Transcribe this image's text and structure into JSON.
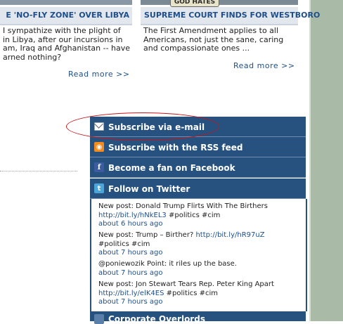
{
  "stories": [
    {
      "headline": "E 'NO-FLY ZONE' OVER LIBYA",
      "body": "I sympathize with the plight of\nin Libya, after our incursions in\nam, Iraq and Afghanistan -- have\narned nothing?",
      "read_more": "Read more >>"
    },
    {
      "sign_text": "GOD HATES",
      "headline": "SUPREME COURT FINDS FOR WESTBORO",
      "body": "The First Amendment applies to all\nAmericans, not just the sane, caring\nand compassionate ones ...",
      "read_more": "Read more >>"
    }
  ],
  "sidebar": {
    "items": [
      {
        "label": "Subscribe via e-mail",
        "icon": "mail-icon"
      },
      {
        "label": "Subscribe with the RSS feed",
        "icon": "rss-icon"
      },
      {
        "label": "Become a fan on Facebook",
        "icon": "facebook-icon"
      },
      {
        "label": "Follow on Twitter",
        "icon": "twitter-icon"
      }
    ],
    "tweets": [
      {
        "text": "New post: Donald Trump Flirts With The Birthers",
        "link": "http://bit.ly/hNkEL3",
        "after": " #politics #cim",
        "time": "about 6 hours ago"
      },
      {
        "text": "New post: Trump – Birther? ",
        "link": "http://bit.ly/hR97uZ",
        "after": "#politics #cim",
        "time": "about 7 hours ago"
      },
      {
        "mention": "@poniewozik",
        "text": " Point: it riles up the base.",
        "time": "about 7 hours ago"
      },
      {
        "text": "New post: Jon Stewart Tears Rep. Peter King Apart",
        "link": "http://bit.ly/elK4ES",
        "after": " #politics #cim",
        "time": "about 7 hours ago"
      }
    ],
    "next_section": "Corporate Overlords"
  },
  "colors": {
    "accent_blue": "#27527f",
    "link": "#1e4f8c",
    "highlight_circle": "#c8141a"
  }
}
